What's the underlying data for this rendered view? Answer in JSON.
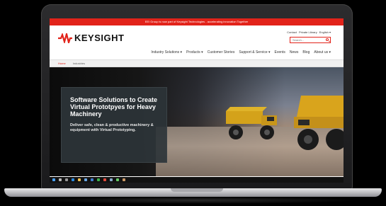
{
  "announcement": "EEI Group is now part of Keysight Technologies - accelerating innovation Together",
  "brand": {
    "name": "KEYSIGHT",
    "accent_color": "#e2231a"
  },
  "utility_links": [
    "Contact",
    "Private Library",
    "English ▾"
  ],
  "search": {
    "placeholder": "Search..."
  },
  "nav": [
    "Industry Solutions ▾",
    "Products ▾",
    "Customer Stories",
    "Support & Service ▾",
    "Events",
    "News",
    "Blog",
    "About us ▾"
  ],
  "breadcrumb": [
    "Home",
    "Industries"
  ],
  "hero": {
    "title": "Software Solutions to Create Virtual Prototpyes for Heavy Machinery",
    "subtitle": "Deliver safe, clean & productive machinery & equipment with Virtual Prototyping."
  },
  "taskbar": {
    "icons": [
      "start-icon",
      "search-icon",
      "task-view-icon",
      "edge-icon",
      "folder-icon",
      "store-icon",
      "mail-icon",
      "chrome-icon",
      "app-icon",
      "app-icon",
      "app-icon",
      "app-icon"
    ],
    "time": "",
    "date": ""
  }
}
